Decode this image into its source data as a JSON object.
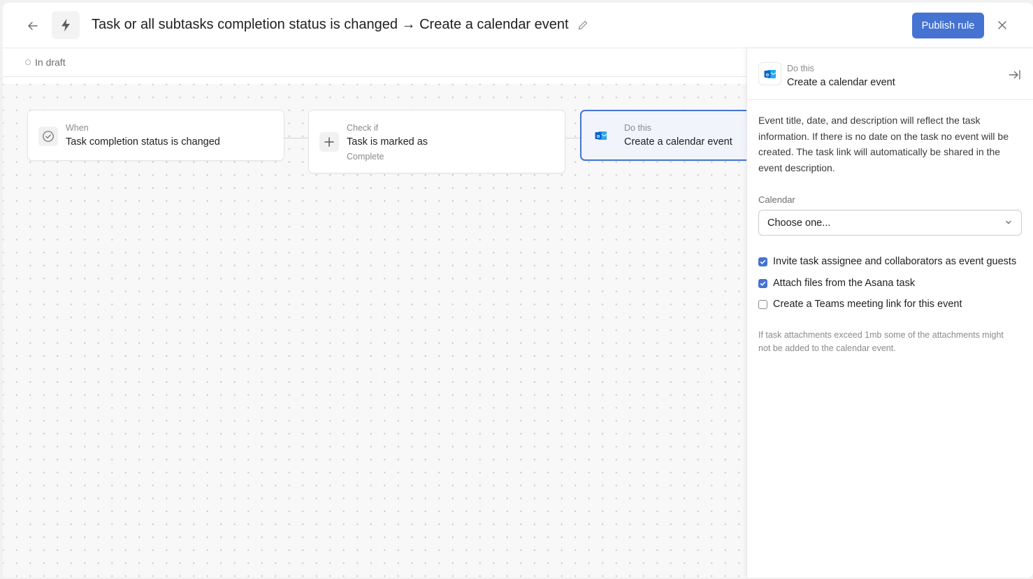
{
  "header": {
    "title": "Task or all subtasks completion status is changed → Create a calendar event",
    "publish_label": "Publish rule",
    "icons": {
      "back": "arrow-left-icon",
      "rule": "lightning-icon",
      "edit": "pencil-icon",
      "close": "close-icon"
    }
  },
  "status": {
    "label": "In draft"
  },
  "workflow": {
    "nodes": [
      {
        "label": "When",
        "main": "Task completion status is changed",
        "sub": "",
        "icon": "check-circle-icon"
      },
      {
        "label": "Check if",
        "main": "Task is marked as",
        "sub": "Complete",
        "icon": "plus-icon"
      },
      {
        "label": "Do this",
        "main": "Create a calendar event",
        "sub": "",
        "icon": "outlook-icon",
        "selected": true
      }
    ]
  },
  "panel": {
    "label": "Do this",
    "title": "Create a calendar event",
    "description": "Event title, date, and description will reflect the task information. If there is no date on the task no event will be created. The task link will automatically be shared in the event description.",
    "calendar_label": "Calendar",
    "calendar_value": "Choose one...",
    "options": [
      {
        "label": "Invite task assignee and collaborators as event guests",
        "checked": true
      },
      {
        "label": "Attach files from the Asana task",
        "checked": true
      },
      {
        "label": "Create a Teams meeting link for this event",
        "checked": false
      }
    ],
    "note": "If task attachments exceed 1mb some of the attachments might not be added to the calendar event.",
    "colors": {
      "accent": "#4573d2",
      "outlook": "#0a64c8"
    }
  }
}
